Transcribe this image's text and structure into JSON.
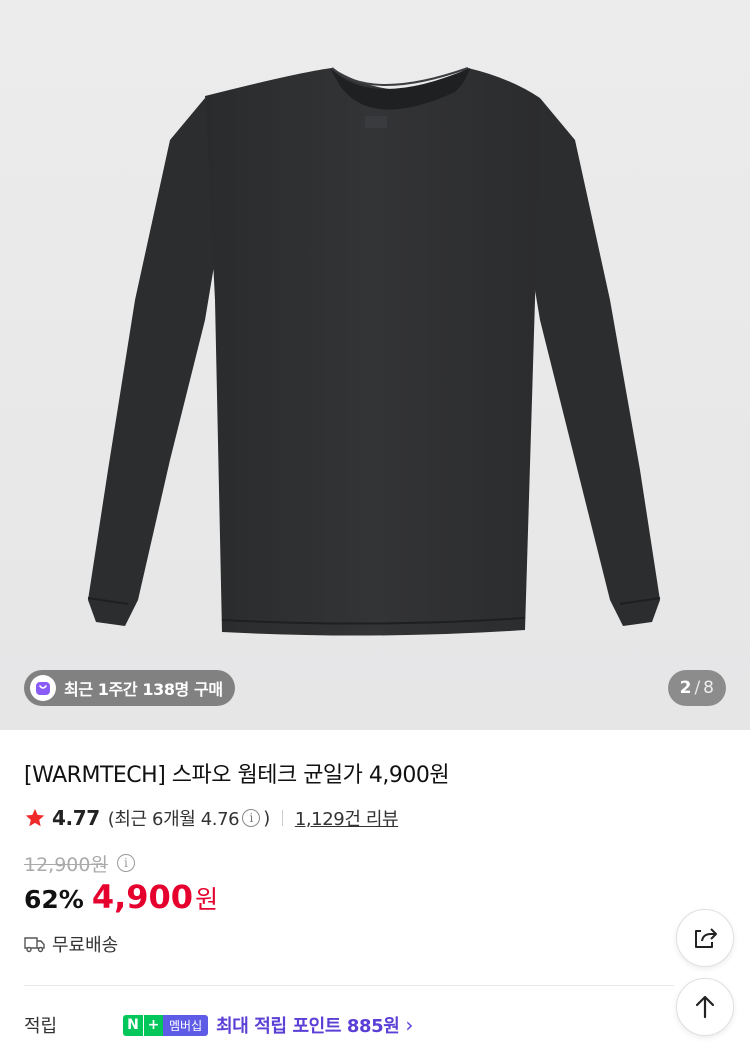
{
  "gallery": {
    "recent_buyers_badge": "최근 1주간 138명 구매",
    "current_index": "2",
    "separator": "/",
    "total": "8"
  },
  "product": {
    "title": "[WARMTECH] 스파오 웜테크 균일가 4,900원",
    "rating": {
      "score": "4.77",
      "recent_label_prefix": "(최근 6개월 4.76",
      "recent_label_suffix": ")",
      "reviews": "1,129건 리뷰"
    },
    "price": {
      "original": "12,900원",
      "discount": "62%",
      "current": "4,900",
      "currency": "원"
    },
    "shipping": "무료배송",
    "points": {
      "label": "적립",
      "npay_n": "N",
      "npay_plus": "+",
      "npay_membership": "멤버십",
      "text": "최대 적립 포인트 885원",
      "chevron": "›"
    }
  },
  "colors": {
    "accent_red": "#e5002e",
    "point_purple": "#5b3fd6",
    "npay_green": "#03c75a",
    "star": "#f02a2a"
  },
  "icons": [
    "star-icon",
    "info-icon",
    "truck-icon",
    "share-icon",
    "arrow-up-icon",
    "shopping-bag-icon"
  ]
}
